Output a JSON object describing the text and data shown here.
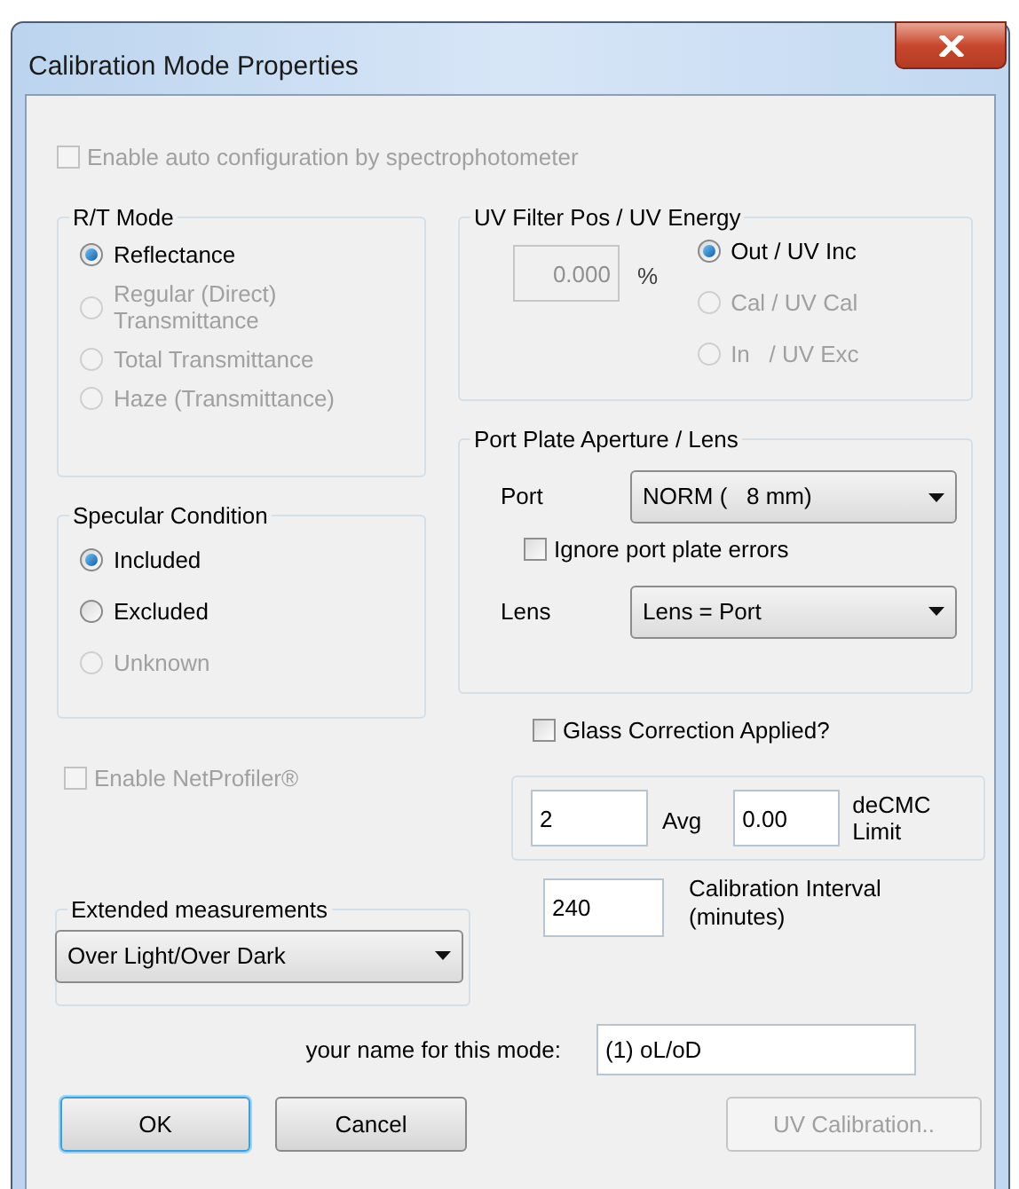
{
  "window": {
    "title": "Calibration Mode Properties"
  },
  "auto_config": {
    "label": "Enable auto configuration by spectrophotometer",
    "checked": false,
    "disabled": true
  },
  "rt_mode": {
    "title": "R/T Mode",
    "options": [
      {
        "label": "Reflectance",
        "selected": true,
        "disabled": false
      },
      {
        "label": "Regular  (Direct) Transmittance",
        "selected": false,
        "disabled": true
      },
      {
        "label": "Total Transmittance",
        "selected": false,
        "disabled": true
      },
      {
        "label": "Haze (Transmittance)",
        "selected": false,
        "disabled": true
      }
    ]
  },
  "specular": {
    "title": "Specular Condition",
    "options": [
      {
        "label": "Included",
        "selected": true,
        "disabled": false
      },
      {
        "label": "Excluded",
        "selected": false,
        "disabled": false
      },
      {
        "label": "Unknown",
        "selected": false,
        "disabled": true
      }
    ]
  },
  "uv_filter": {
    "title": "UV Filter Pos / UV Energy",
    "value": "0.000",
    "unit": "%",
    "options": [
      {
        "label": "Out / UV Inc",
        "selected": true,
        "disabled": false
      },
      {
        "label": "Cal / UV Cal",
        "selected": false,
        "disabled": true
      },
      {
        "label": "In   / UV Exc",
        "selected": false,
        "disabled": true
      }
    ]
  },
  "port_plate": {
    "title": "Port Plate Aperture / Lens",
    "port_label": "Port",
    "port_value": "NORM (   8 mm)",
    "ignore_errors": {
      "label": "Ignore port plate errors",
      "checked": false
    },
    "lens_label": "Lens",
    "lens_value": "Lens = Port"
  },
  "glass_correction": {
    "label": "Glass Correction Applied?",
    "checked": false,
    "disabled": false
  },
  "netprofiler": {
    "label": "Enable NetProfiler®",
    "checked": false,
    "disabled": true
  },
  "averaging": {
    "avg_value": "2",
    "avg_label": "Avg",
    "limit_value": "0.00",
    "limit_label": "deCMC Limit"
  },
  "extended": {
    "title": "Extended measurements",
    "value": "Over Light/Over Dark"
  },
  "interval": {
    "value": "240",
    "label": "Calibration Interval (minutes)"
  },
  "mode_name": {
    "label": "your name for this mode:",
    "value": "(1) oL/oD"
  },
  "buttons": [
    {
      "label": "OK",
      "default": true,
      "disabled": false
    },
    {
      "label": "Cancel",
      "default": false,
      "disabled": false
    },
    {
      "label": "UV Calibration..",
      "default": false,
      "disabled": true
    }
  ]
}
